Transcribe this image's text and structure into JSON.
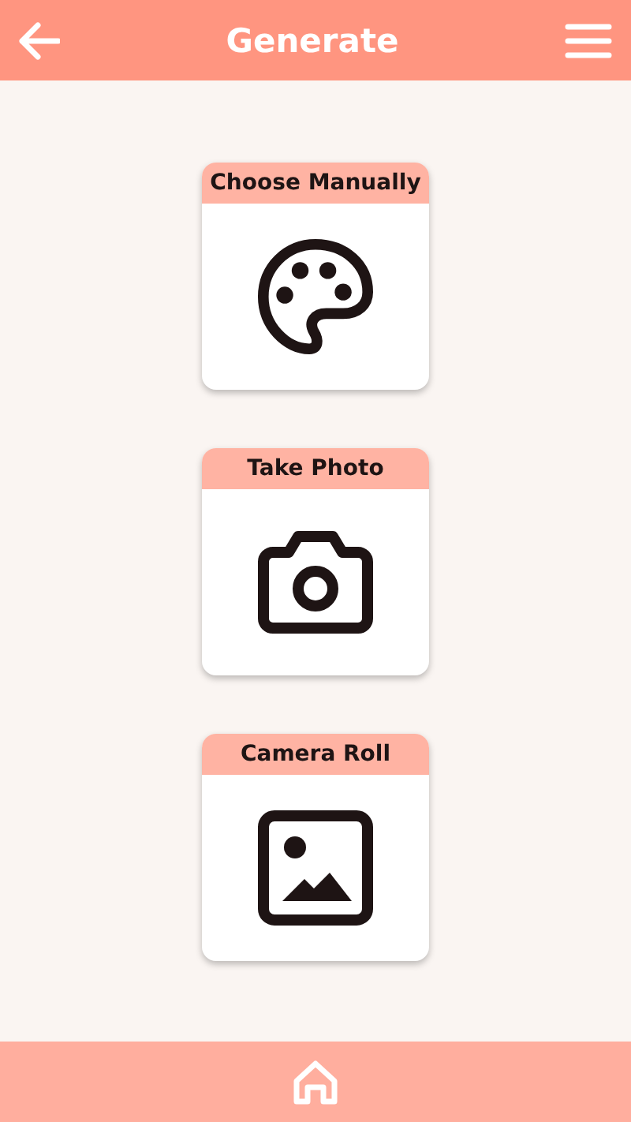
{
  "header": {
    "title": "Generate"
  },
  "options": [
    {
      "label": "Choose Manually",
      "kind": "palette"
    },
    {
      "label": "Take Photo",
      "kind": "camera"
    },
    {
      "label": "Camera Roll",
      "kind": "image"
    }
  ]
}
